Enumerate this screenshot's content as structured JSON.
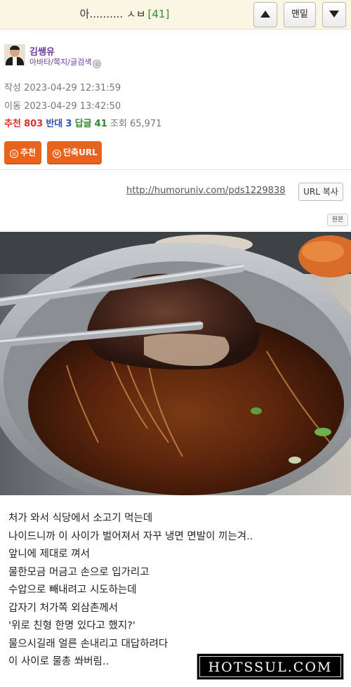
{
  "header": {
    "title": "아.......... ㅅㅂ",
    "count": "[41]",
    "up_label": "▲",
    "top_label": "맨밑",
    "down_label": "▼"
  },
  "author": {
    "name": "김쌩유",
    "links": "아바타/쪽지/글검색",
    "badge": "◎"
  },
  "meta": {
    "written_label": "작성",
    "written": "2023-04-29 12:31:59",
    "moved_label": "이동",
    "moved": "2023-04-29 13:42:50"
  },
  "stats": {
    "rec_label": "추천",
    "rec": "803",
    "opp_label": "반대",
    "opp": "3",
    "reply_label": "답글",
    "reply": "41",
    "view_label": "조회",
    "view": "65,971"
  },
  "buttons": {
    "recommend": "추천",
    "recommend_icon": "◎",
    "short_url": "단축URL",
    "short_url_icon": "U"
  },
  "share": {
    "url": "http://humoruniv.com/pds1229838",
    "copy": "URL 복사",
    "original": "원본"
  },
  "body": {
    "lines": [
      "처가 와서 식당에서 소고기 먹는데",
      "나이드니까 이 사이가 벌어져서 자꾸 냉면 면발이 끼는겨..",
      "앞니에 제대로 껴서",
      "물한모금 머금고 손으로 입가리고",
      "수압으로 빼내려고 시도하는데",
      "갑자기 처가쪽 외삼촌께서",
      "'위로 친형 한명 있다고 했지?'",
      "물으시길래 얼른 손내리고 대답하려다",
      "이 사이로 물총 쏴버림.."
    ]
  },
  "watermark": "HOTSSUL.COM",
  "colors": {
    "header_bg": "#fbf5e3",
    "accent_orange": "#e8631c",
    "author_purple": "#6a3aa0",
    "rec_red": "#d9342b",
    "opp_blue": "#2a4fb5",
    "reply_green": "#2a8a2a"
  }
}
